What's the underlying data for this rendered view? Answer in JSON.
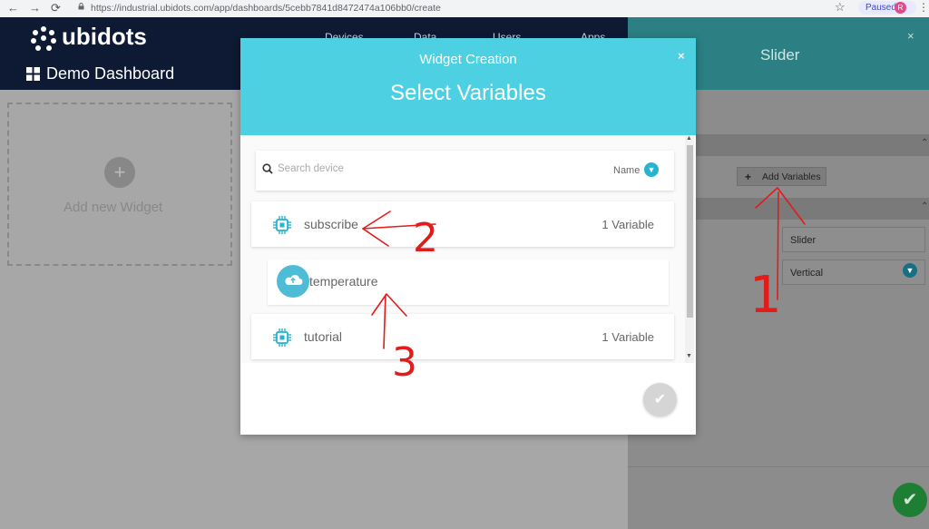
{
  "browser": {
    "url": "https://industrial.ubidots.com/app/dashboards/5cebb7841d8472474a106bb0/create",
    "profile_status": "Paused",
    "profile_initial": "R"
  },
  "app": {
    "logo_text": "ubidots",
    "nav": [
      "Devices",
      "Data",
      "Users",
      "Apps"
    ],
    "dashboard_title": "Demo Dashboard",
    "add_widget_label": "Add new Widget",
    "add_widget_symbol": "+"
  },
  "panel": {
    "title": "Slider",
    "close": "×",
    "add_variables_label": "Add Variables",
    "add_symbol": "+",
    "name_value": "Slider",
    "orientation_value": "Vertical",
    "accent": "#2c7f82"
  },
  "modal": {
    "subtitle": "Widget Creation",
    "title": "Select Variables",
    "close": "×",
    "search_placeholder": "Search device",
    "sort_label": "Name",
    "accent": "#4dd0e1",
    "devices": [
      {
        "name": "subscribe",
        "count": "1 Variable",
        "icon": "chip-icon"
      },
      {
        "name": "temperature",
        "count": "",
        "icon": "cloud-upload-icon"
      },
      {
        "name": "tutorial",
        "count": "1 Variable",
        "icon": "chip-icon"
      }
    ]
  },
  "annotations": [
    "1",
    "2",
    "3"
  ]
}
